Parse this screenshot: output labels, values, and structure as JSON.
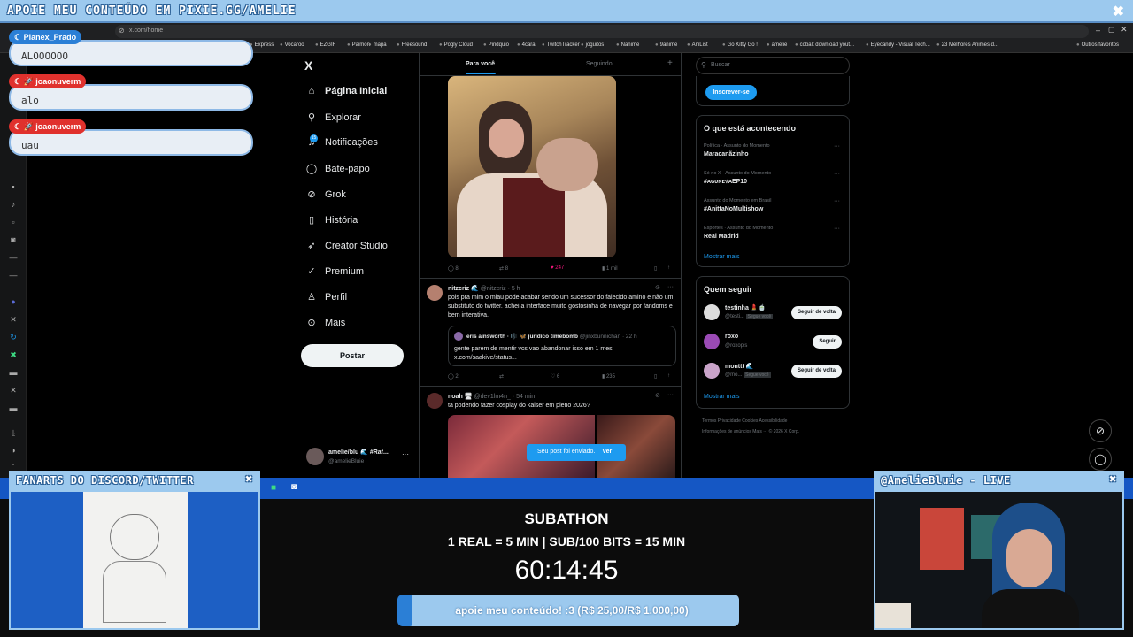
{
  "top_banner": {
    "title": "APOIE MEU CONTEÚDO EM PIXIE.GG/AMELIE",
    "close": "✖"
  },
  "browser": {
    "url": "x.com/home",
    "bookmarks": [
      "Express",
      "Vocaroo",
      "EZGIF",
      "Paimon",
      "mapa",
      "Freesound",
      "Pogly Cloud",
      "Pindquio",
      "4cara",
      "TwitchTracker",
      "joguitos",
      "Nanime",
      "9anime",
      "AniList",
      "Go Kitty Go !",
      "amelie",
      "cobalt download yout...",
      "Eyecandy - Visual Tech...",
      "23 Melhores Animes d...",
      "Outros favoritos"
    ]
  },
  "chat": [
    {
      "user": "Planex_Prado",
      "message": "ALOOOOOO"
    },
    {
      "user": "joaonuverm",
      "message": "alo"
    },
    {
      "user": "joaonuverm",
      "message": "uau"
    }
  ],
  "x_nav": {
    "logo": "X",
    "items": [
      {
        "label": "Página Inicial",
        "icon": "home-icon"
      },
      {
        "label": "Explorar",
        "icon": "search-icon"
      },
      {
        "label": "Notificações",
        "icon": "bell-icon",
        "badge": "15"
      },
      {
        "label": "Bate-papo",
        "icon": "chat-icon"
      },
      {
        "label": "Grok",
        "icon": "grok-icon"
      },
      {
        "label": "História",
        "icon": "bookmark-icon"
      },
      {
        "label": "Creator Studio",
        "icon": "rocket-icon"
      },
      {
        "label": "Premium",
        "icon": "check-icon"
      },
      {
        "label": "Perfil",
        "icon": "person-icon"
      },
      {
        "label": "Mais",
        "icon": "more-icon"
      }
    ],
    "post_button": "Postar",
    "account_name": "amelie/blu 🌊 #Raf...",
    "account_handle": "@amelieBluie"
  },
  "timeline": {
    "tabs": [
      "Para você",
      "Seguindo"
    ],
    "tweet1_stats": {
      "replies": "8",
      "retweets": "8",
      "likes": "247",
      "views": "1 mil"
    },
    "tweet2": {
      "author": "nitzcriz 🌊",
      "handle": "@nitzcriz · 5 h",
      "text": "pois pra mim o miau pode acabar sendo um sucessor do falecido amino e não um substituto do twitter. achei a interface muito gostosinha de navegar por fandoms e bem interativa.",
      "quote_author": "eris ainsworth · 🎼 🦋 jurídico timebomb",
      "quote_handle": "@jinxbunnichan · 22 h",
      "quote_text": "gente parem de mentir vcs vao abandonar isso em 1 mes x.com/saakive/status...",
      "stats": {
        "replies": "2",
        "retweets": "",
        "likes": "6",
        "views": "235"
      }
    },
    "tweet3": {
      "author": "noah 🖥",
      "handle": "@dev1lm4n_ · 54 min",
      "text": "ta podendo fazer cosplay do kaiser em pleno 2026?"
    },
    "toast": {
      "text": "Seu post foi enviado.",
      "action": "Ver"
    }
  },
  "right": {
    "search_placeholder": "Buscar",
    "subscribe": "Inscrever-se",
    "trends_title": "O que está acontecendo",
    "trends": [
      {
        "meta": "Política · Assunto do Momento",
        "name": "Maracanãzinho"
      },
      {
        "meta": "Só no X · Assunto do Momento",
        "name": "#ᴀɢᴜɴᴇ√ᴀEP10"
      },
      {
        "meta": "Assunto do Momento em Brasil",
        "name": "#AnittaNoMultishow"
      },
      {
        "meta": "Esportes · Assunto do Momento",
        "name": "Real Madrid"
      }
    ],
    "show_more": "Mostrar mais",
    "follow_title": "Quem seguir",
    "follow": [
      {
        "name": "testinha 💄🍵",
        "handle": "@testi...",
        "tag": "Segue você",
        "button": "Seguir de volta"
      },
      {
        "name": "roxo",
        "handle": "@roxopls",
        "tag": "",
        "button": "Seguir"
      },
      {
        "name": "monttt 🌊",
        "handle": "@mo...",
        "tag": "Segue você",
        "button": "Seguir de volta"
      }
    ],
    "footer1": "Termos  Privacidade  Cookies  Acessibilidade",
    "footer2": "Informações de anúncios  Mais ···  © 2026 X Corp."
  },
  "overlay": {
    "fanarts_title": "FANARTS DO DISCORD/TWITTER",
    "live_title": "@AmelieBluie  - LIVE",
    "subathon_title": "SUBATHON",
    "subathon_rate": "1 REAL = 5 MIN | SUB/100 BITS = 15 MIN",
    "timer": "60:14:45",
    "support": "apoie meu conteúdo! :3 (R$ 25,00/R$ 1.000,00)",
    "support_progress": 0.025
  },
  "colors": {
    "accent_blue": "#9cc9ee",
    "x_blue": "#1d9bf0",
    "chat_red": "#e0312d"
  }
}
